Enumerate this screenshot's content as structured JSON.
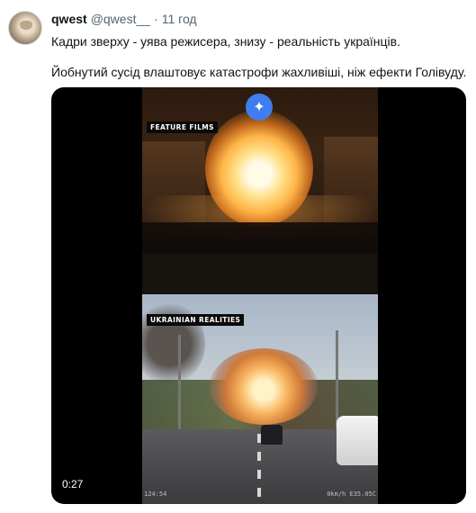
{
  "author": {
    "name": "qwest",
    "handle": "@qwest__",
    "separator": "·",
    "time": "11 год"
  },
  "tweet": {
    "line1": "Кадри зверху - уява режисера, знизу - реальність українців.",
    "line2": "Йобнутий сусід влаштовує катастрофи жахливіші, ніж ефекти Голівуду."
  },
  "video": {
    "label_top": "FEATURE FILMS",
    "label_bottom": "UKRAINIAN REALITIES",
    "duration": "0:27",
    "dash_left": "124:54",
    "dash_right": "0km/h  E35.05C",
    "gemini_icon": "✦"
  },
  "colors": {
    "background": "#ffffff",
    "text": "#0f1419",
    "secondary_text": "#536471",
    "gemini_button": "#3f7df0",
    "video_bg": "#000000"
  }
}
